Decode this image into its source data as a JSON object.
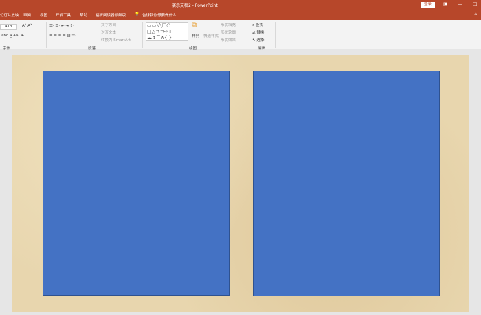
{
  "window": {
    "title": "演示文稿2 - PowerPoint",
    "login": "登录",
    "restore_icon": "restore",
    "minimize": "—",
    "maximize": "□"
  },
  "tabs": [
    "幻灯片放映",
    "审阅",
    "视图",
    "开发工具",
    "帮助",
    "福昕阅读器领鲜版"
  ],
  "tell_me": "告诉我你想要做什么",
  "ribbon": {
    "font_size": "413",
    "para": {
      "text_direction": "文字方向",
      "align_text": "对齐文本",
      "smartart": "转换为 SmartArt"
    },
    "drawing": {
      "arrange": "排列",
      "quick_styles": "快速样式",
      "shape_fill": "形状填充",
      "shape_outline": "形状轮廓",
      "shape_effects": "形状效果"
    },
    "editing": {
      "find": "查找",
      "replace": "替换",
      "select": "选择"
    },
    "groups": {
      "font": "字体",
      "paragraph": "段落",
      "drawing": "绘图",
      "editing": "编辑"
    }
  },
  "colors": {
    "accent": "#b7472a",
    "panel": "#4472c4"
  }
}
